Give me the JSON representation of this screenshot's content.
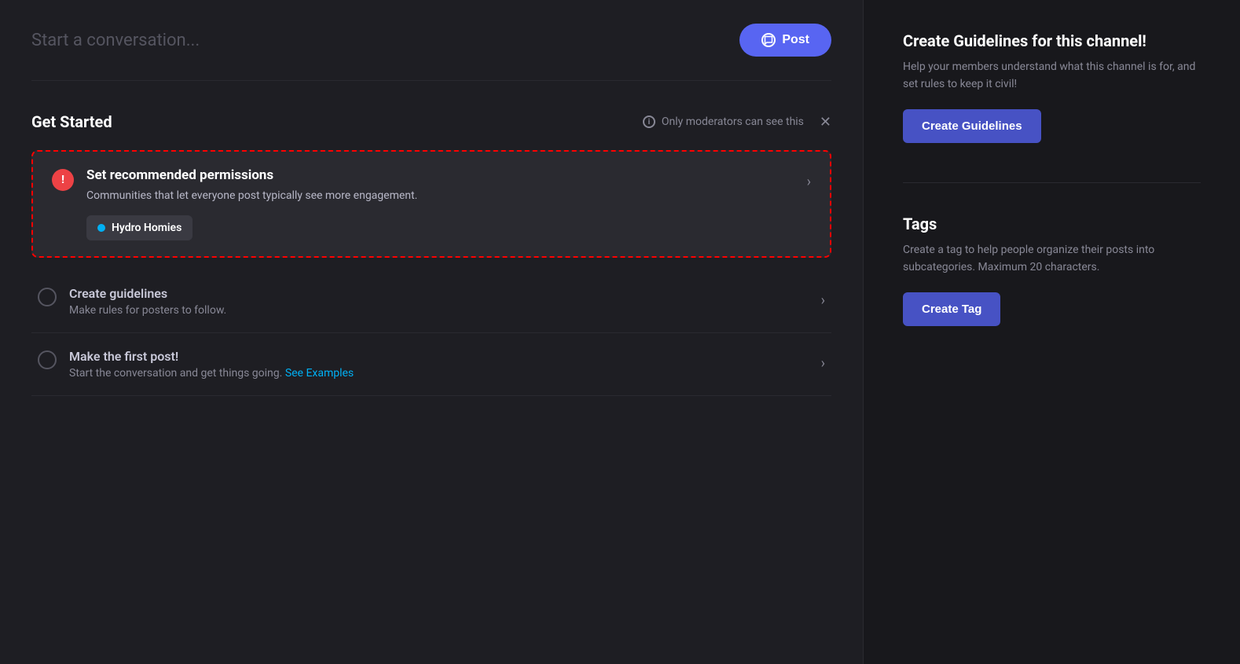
{
  "conversation": {
    "placeholder": "Start a conversation...",
    "post_button_label": "Post"
  },
  "get_started": {
    "title": "Get Started",
    "moderators_notice": "Only moderators can see this",
    "permissions_card": {
      "title": "Set recommended permissions",
      "description": "Communities that let everyone post typically see more engagement.",
      "channel_name": "Hydro Homies"
    },
    "checklist_items": [
      {
        "title": "Create guidelines",
        "description": "Make rules for posters to follow.",
        "see_examples": false
      },
      {
        "title": "Make the first post!",
        "description": "Start the conversation and get things going.",
        "see_examples": true,
        "see_examples_label": "See Examples"
      }
    ]
  },
  "sidebar": {
    "guidelines_section": {
      "title": "Create Guidelines for this channel!",
      "description": "Help your members understand what this channel is for, and set rules to keep it civil!",
      "button_label": "Create Guidelines"
    },
    "tags_section": {
      "title": "Tags",
      "description": "Create a tag to help people organize their posts into subcategories. Maximum 20 characters.",
      "button_label": "Create Tag"
    }
  }
}
